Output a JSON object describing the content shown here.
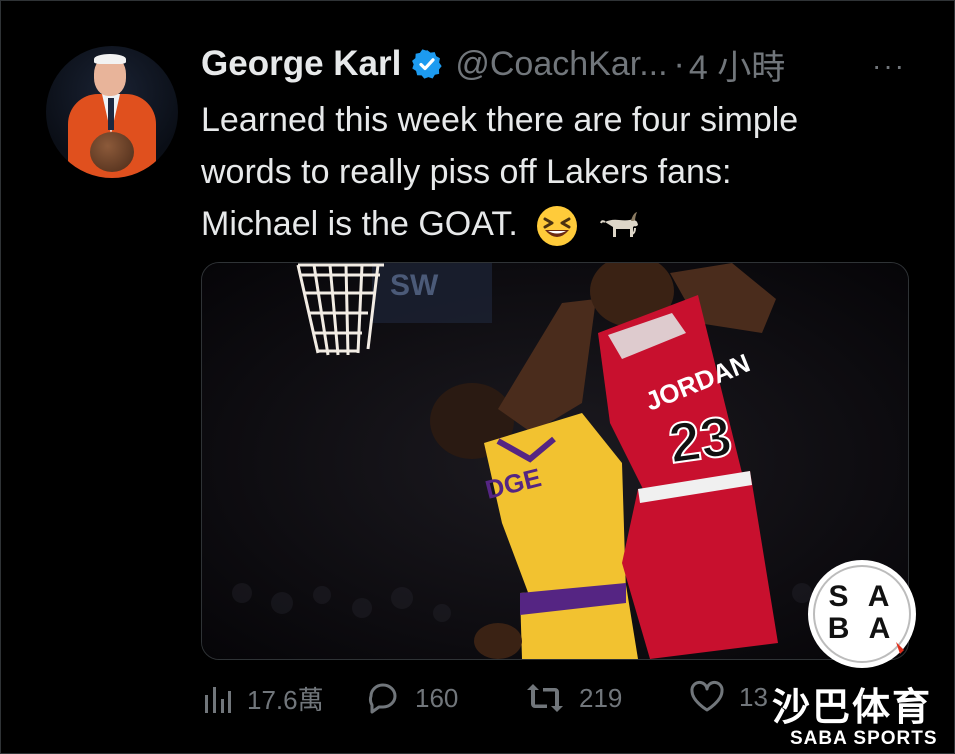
{
  "tweet": {
    "author_name": "George Karl",
    "handle": "@CoachKar...",
    "separator": "·",
    "time": "4 小時",
    "more": "···",
    "text_lines": [
      "Learned this week there are four simple",
      "words to really piss off Lakers fans:",
      "Michael is the GOAT."
    ],
    "emojis": [
      "grinning-squinting-face-icon",
      "goat-icon"
    ],
    "media": {
      "jersey_name": "JORDAN",
      "jersey_number": "23",
      "lakers_name": "DGE",
      "arena_sign": "SW"
    }
  },
  "actions": {
    "views": "17.6萬",
    "replies": "160",
    "retweets": "219",
    "likes": "13"
  },
  "watermark": {
    "logo_text": "SABA",
    "chinese": "沙巴体育",
    "english": "SABA SPORTS"
  },
  "colors": {
    "background": "#000000",
    "text": "#e7e9ea",
    "muted": "#71767b",
    "verified": "#1d9bf0",
    "bulls_red": "#c8102e",
    "lakers_gold": "#f2c230",
    "lakers_purple": "#552583"
  }
}
